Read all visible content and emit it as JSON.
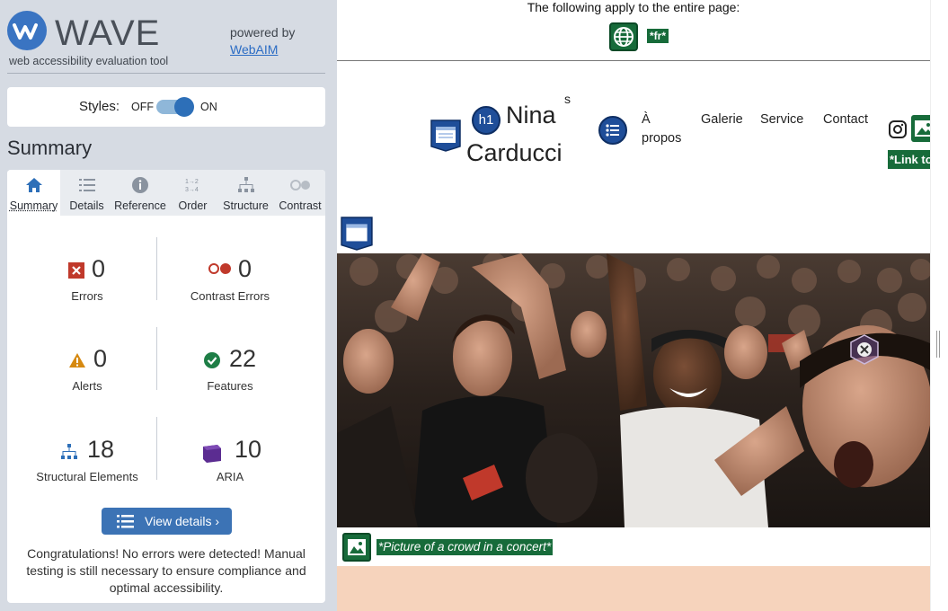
{
  "wave": {
    "logo_text": "WAVE",
    "tagline": "web accessibility evaluation tool",
    "powered_by": "powered by",
    "webaim_link": "WebAIM"
  },
  "styles": {
    "label": "Styles:",
    "off": "OFF",
    "on": "ON",
    "state": "on"
  },
  "summary": {
    "title": "Summary",
    "tabs": [
      {
        "label": "Summary",
        "icon": "home-icon",
        "active": true
      },
      {
        "label": "Details",
        "icon": "list-icon",
        "active": false
      },
      {
        "label": "Reference",
        "icon": "info-icon",
        "active": false
      },
      {
        "label": "Order",
        "icon": "order-icon",
        "active": false
      },
      {
        "label": "Structure",
        "icon": "structure-icon",
        "active": false
      },
      {
        "label": "Contrast",
        "icon": "contrast-icon",
        "active": false
      }
    ],
    "stats": [
      {
        "label": "Errors",
        "value": "0",
        "icon": "error-icon",
        "color": "#c0392b"
      },
      {
        "label": "Contrast Errors",
        "value": "0",
        "icon": "contrast-error-icon",
        "color": "#c0392b"
      },
      {
        "label": "Alerts",
        "value": "0",
        "icon": "alert-icon",
        "color": "#d68910"
      },
      {
        "label": "Features",
        "value": "22",
        "icon": "feature-icon",
        "color": "#1e7e46"
      },
      {
        "label": "Structural Elements",
        "value": "18",
        "icon": "structure-icon",
        "color": "#2d6fb8"
      },
      {
        "label": "ARIA",
        "value": "10",
        "icon": "aria-icon",
        "color": "#5b2c91"
      }
    ],
    "view_details": "View details ›",
    "congrats": "Congratulations! No errors were detected! Manual testing is still necessary to ensure compliance and optimal accessibility."
  },
  "page": {
    "apply_text": "The following apply to the entire page:",
    "lang_tag": "*fr*",
    "brand_line1": "Nina",
    "brand_line2": "Carducci",
    "brand_sup": "s",
    "h1_badge": "h1",
    "nav": [
      "À propos",
      "Galerie",
      "Service",
      "Contact"
    ],
    "link_tag": "*Link to Instagram*",
    "alt_tag": "*Picture of a crowd in a concert*"
  }
}
